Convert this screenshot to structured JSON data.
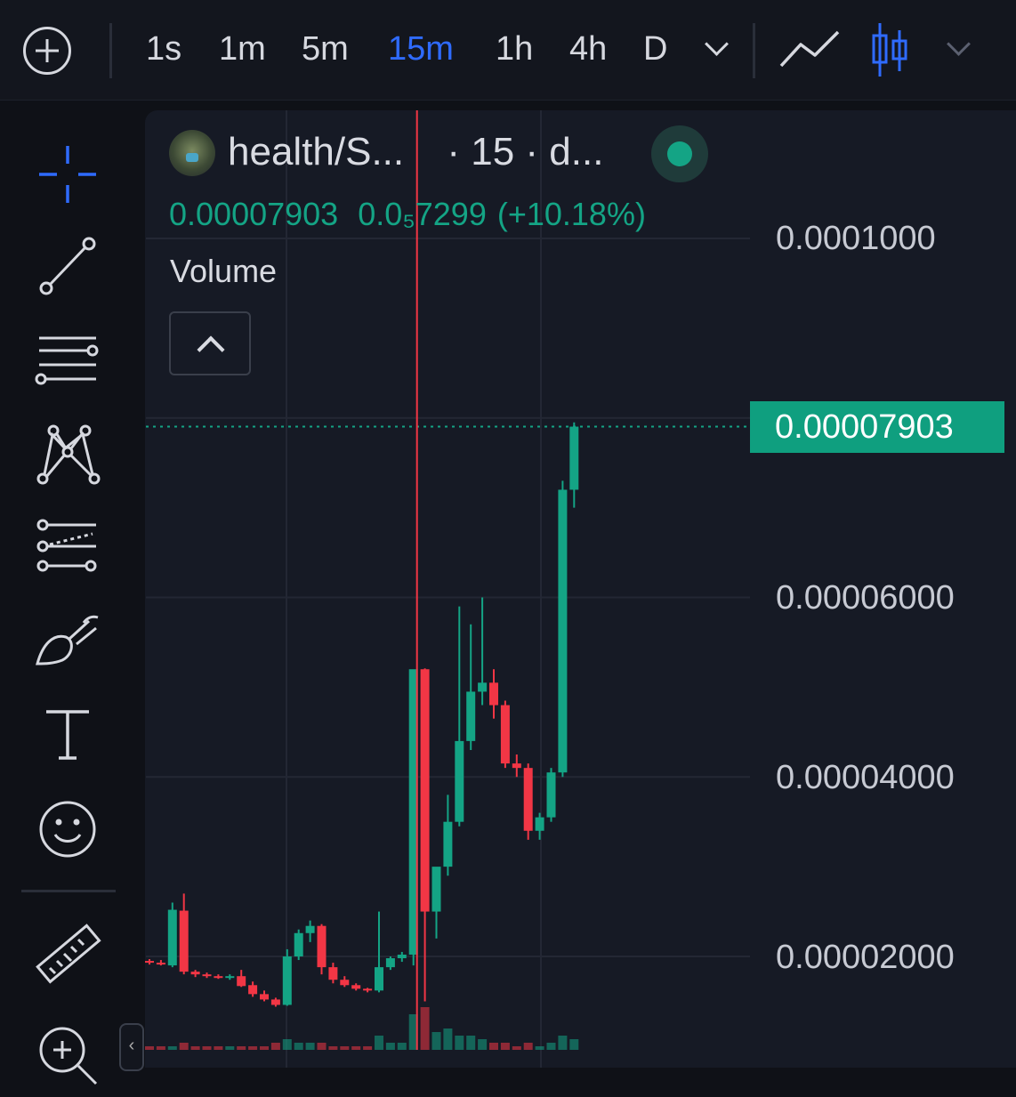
{
  "toolbar": {
    "add_icon": "plus-circle-icon",
    "timeframes": [
      "1s",
      "1m",
      "5m",
      "15m",
      "1h",
      "4h",
      "D"
    ],
    "active_timeframe": "15m",
    "line_chart_icon": "line-chart-icon",
    "candle_chart_icon": "candlestick-icon"
  },
  "tools": [
    "crosshair-icon",
    "trend-line-icon",
    "horizontal-lines-icon",
    "pattern-icon",
    "fib-tools-icon",
    "brush-icon",
    "text-icon",
    "emoji-icon",
    "ruler-icon",
    "zoom-icon"
  ],
  "legend": {
    "symbol": "health/S...",
    "interval_text": "· 15 · d...",
    "close": "0.00007903",
    "change": "0.0₅7299",
    "change_pct": "(+10.18%)",
    "volume_label": "Volume"
  },
  "last_price_label": "0.00007903",
  "colors": {
    "up": "#14a485",
    "down": "#f23645",
    "accent": "#2f6bff",
    "background": "#161a25"
  },
  "chart_data": {
    "type": "candlestick",
    "y_ticks": [
      "0.0001000",
      "0.00006000",
      "0.00004000",
      "0.00002000"
    ],
    "y_tick_values": [
      0.0001,
      6e-05,
      4e-05,
      2e-05
    ],
    "last_price": 7.903e-05,
    "candles": [
      {
        "o": 1.95e-05,
        "h": 1.97e-05,
        "l": 1.91e-05,
        "c": 1.93e-05
      },
      {
        "o": 1.93e-05,
        "h": 1.96e-05,
        "l": 1.9e-05,
        "c": 1.91e-05
      },
      {
        "o": 1.9e-05,
        "h": 2.6e-05,
        "l": 1.88e-05,
        "c": 2.52e-05
      },
      {
        "o": 2.51e-05,
        "h": 2.7e-05,
        "l": 1.8e-05,
        "c": 1.83e-05
      },
      {
        "o": 1.83e-05,
        "h": 1.85e-05,
        "l": 1.77e-05,
        "c": 1.8e-05
      },
      {
        "o": 1.8e-05,
        "h": 1.82e-05,
        "l": 1.76e-05,
        "c": 1.78e-05
      },
      {
        "o": 1.78e-05,
        "h": 1.8e-05,
        "l": 1.75e-05,
        "c": 1.76e-05
      },
      {
        "o": 1.77e-05,
        "h": 1.8e-05,
        "l": 1.74e-05,
        "c": 1.78e-05
      },
      {
        "o": 1.78e-05,
        "h": 1.85e-05,
        "l": 1.66e-05,
        "c": 1.67e-05
      },
      {
        "o": 1.68e-05,
        "h": 1.72e-05,
        "l": 1.55e-05,
        "c": 1.58e-05
      },
      {
        "o": 1.58e-05,
        "h": 1.62e-05,
        "l": 1.5e-05,
        "c": 1.52e-05
      },
      {
        "o": 1.52e-05,
        "h": 1.54e-05,
        "l": 1.44e-05,
        "c": 1.46e-05
      },
      {
        "o": 1.46e-05,
        "h": 2.08e-05,
        "l": 1.45e-05,
        "c": 2e-05
      },
      {
        "o": 2e-05,
        "h": 2.3e-05,
        "l": 1.96e-05,
        "c": 2.26e-05
      },
      {
        "o": 2.26e-05,
        "h": 2.4e-05,
        "l": 2.16e-05,
        "c": 2.34e-05
      },
      {
        "o": 2.34e-05,
        "h": 2.36e-05,
        "l": 1.8e-05,
        "c": 1.88e-05
      },
      {
        "o": 1.88e-05,
        "h": 1.93e-05,
        "l": 1.7e-05,
        "c": 1.74e-05
      },
      {
        "o": 1.74e-05,
        "h": 1.78e-05,
        "l": 1.66e-05,
        "c": 1.68e-05
      },
      {
        "o": 1.68e-05,
        "h": 1.7e-05,
        "l": 1.62e-05,
        "c": 1.64e-05
      },
      {
        "o": 1.64e-05,
        "h": 1.65e-05,
        "l": 1.6e-05,
        "c": 1.62e-05
      },
      {
        "o": 1.62e-05,
        "h": 2.5e-05,
        "l": 1.6e-05,
        "c": 1.88e-05
      },
      {
        "o": 1.88e-05,
        "h": 2e-05,
        "l": 1.85e-05,
        "c": 1.98e-05
      },
      {
        "o": 1.98e-05,
        "h": 2.05e-05,
        "l": 1.94e-05,
        "c": 2.02e-05
      },
      {
        "o": 2.02e-05,
        "h": 3.7e-05,
        "l": 1.9e-05,
        "c": 5.2e-05
      },
      {
        "o": 5.2e-05,
        "h": 5.21e-05,
        "l": 1.5e-05,
        "c": 2.5e-05
      },
      {
        "o": 2.5e-05,
        "h": 2.6e-05,
        "l": 2.2e-05,
        "c": 3e-05
      },
      {
        "o": 3e-05,
        "h": 3.8e-05,
        "l": 2.9e-05,
        "c": 3.5e-05
      },
      {
        "o": 3.5e-05,
        "h": 5.9e-05,
        "l": 3.45e-05,
        "c": 4.4e-05
      },
      {
        "o": 4.4e-05,
        "h": 5.7e-05,
        "l": 4.3e-05,
        "c": 4.95e-05
      },
      {
        "o": 4.95e-05,
        "h": 6e-05,
        "l": 4.8e-05,
        "c": 5.05e-05
      },
      {
        "o": 5.05e-05,
        "h": 5.2e-05,
        "l": 4.65e-05,
        "c": 4.8e-05
      },
      {
        "o": 4.8e-05,
        "h": 4.85e-05,
        "l": 4.1e-05,
        "c": 4.15e-05
      },
      {
        "o": 4.15e-05,
        "h": 4.25e-05,
        "l": 4e-05,
        "c": 4.1e-05
      },
      {
        "o": 4.1e-05,
        "h": 4.15e-05,
        "l": 3.3e-05,
        "c": 3.4e-05
      },
      {
        "o": 3.4e-05,
        "h": 3.6e-05,
        "l": 3.3e-05,
        "c": 3.55e-05
      },
      {
        "o": 3.55e-05,
        "h": 4.1e-05,
        "l": 3.5e-05,
        "c": 4.05e-05
      },
      {
        "o": 4.05e-05,
        "h": 7.3e-05,
        "l": 4e-05,
        "c": 7.2e-05
      },
      {
        "o": 7.2e-05,
        "h": 7.95e-05,
        "l": 7e-05,
        "c": 7.903e-05
      }
    ],
    "volume": [
      1,
      1,
      1,
      2,
      1,
      1,
      1,
      1,
      1,
      1,
      1,
      2,
      3,
      2,
      2,
      2,
      1,
      1,
      1,
      1,
      4,
      2,
      2,
      10,
      12,
      5,
      6,
      4,
      4,
      3,
      2,
      2,
      1,
      2,
      1,
      2,
      4,
      3
    ]
  }
}
